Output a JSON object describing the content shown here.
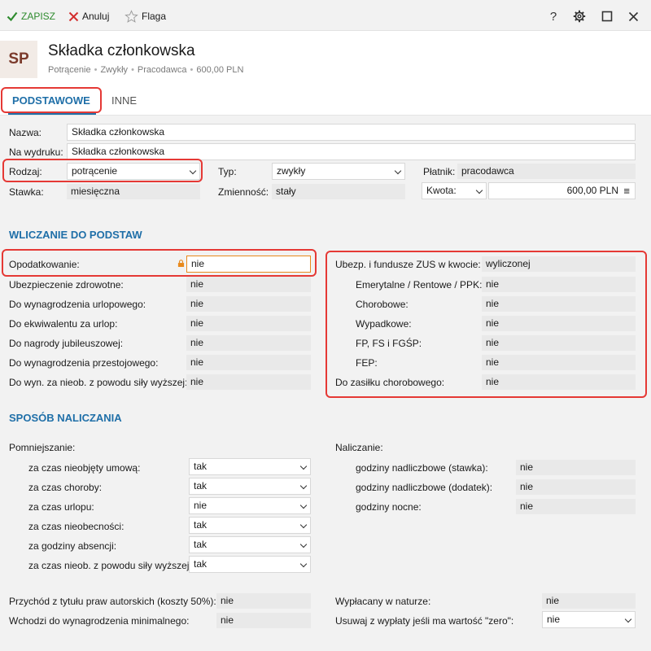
{
  "toolbar": {
    "save_label": "ZAPISZ",
    "cancel_label": "Anuluj",
    "flag_label": "Flaga",
    "help_label": "?"
  },
  "header": {
    "avatar": "SP",
    "title": "Składka członkowska",
    "crumbs": [
      "Potrącenie",
      "Zwykły",
      "Pracodawca",
      "600,00 PLN"
    ]
  },
  "tabs": [
    "PODSTAWOWE",
    "INNE"
  ],
  "form": {
    "nazwa_label": "Nazwa:",
    "nazwa_value": "Składka członkowska",
    "wydruk_label": "Na wydruku:",
    "wydruk_value": "Składka członkowska",
    "rodzaj_label": "Rodzaj:",
    "rodzaj_value": "potrącenie",
    "typ_label": "Typ:",
    "typ_value": "zwykły",
    "platnik_label": "Płatnik:",
    "platnik_value": "pracodawca",
    "stawka_label": "Stawka:",
    "stawka_value": "miesięczna",
    "zmiennosc_label": "Zmienność:",
    "zmiennosc_value": "stały",
    "kwota_label": "Kwota:",
    "kwota_value": "600,00 PLN",
    "kwota_menu": "≡"
  },
  "wliczanie": {
    "title": "WLICZANIE DO PODSTAW",
    "left": [
      {
        "label": "Opodatkowanie:",
        "value": "nie"
      },
      {
        "label": "Ubezpieczenie zdrowotne:",
        "value": "nie"
      },
      {
        "label": "Do wynagrodzenia urlopowego:",
        "value": "nie"
      },
      {
        "label": "Do ekwiwalentu za urlop:",
        "value": "nie"
      },
      {
        "label": "Do nagrody jubileuszowej:",
        "value": "nie"
      },
      {
        "label": "Do wynagrodzenia przestojowego:",
        "value": "nie"
      },
      {
        "label": "Do wyn. za nieob. z powodu siły wyższej:",
        "value": "nie"
      }
    ],
    "right": [
      {
        "label": "Ubezp. i fundusze ZUS w kwocie:",
        "value": "wyliczonej"
      },
      {
        "label": "Emerytalne / Rentowe / PPK:",
        "value": "nie"
      },
      {
        "label": "Chorobowe:",
        "value": "nie"
      },
      {
        "label": "Wypadkowe:",
        "value": "nie"
      },
      {
        "label": "FP, FS i FGŚP:",
        "value": "nie"
      },
      {
        "label": "FEP:",
        "value": "nie"
      },
      {
        "label": "Do zasiłku chorobowego:",
        "value": "nie"
      }
    ]
  },
  "sposob": {
    "title": "SPOSÓB NALICZANIA",
    "pomniejszanie_label": "Pomniejszanie:",
    "pomniejszanie": [
      {
        "label": "za czas nieobjęty umową:",
        "value": "tak"
      },
      {
        "label": "za czas choroby:",
        "value": "tak"
      },
      {
        "label": "za czas urlopu:",
        "value": "nie"
      },
      {
        "label": "za czas nieobecności:",
        "value": "tak"
      },
      {
        "label": "za godziny absencji:",
        "value": "tak"
      },
      {
        "label": "za czas nieob. z powodu siły wyższej:",
        "value": "tak"
      }
    ],
    "naliczanie_label": "Naliczanie:",
    "naliczanie": [
      {
        "label": "godziny nadliczbowe (stawka):",
        "value": "nie"
      },
      {
        "label": "godziny nadliczbowe (dodatek):",
        "value": "nie"
      },
      {
        "label": "godziny nocne:",
        "value": "nie"
      }
    ]
  },
  "bottom": {
    "przychod_label": "Przychód z tytułu praw autorskich (koszty 50%):",
    "przychod_value": "nie",
    "minimalne_label": "Wchodzi do wynagrodzenia minimalnego:",
    "minimalne_value": "nie",
    "natura_label": "Wypłacany w naturze:",
    "natura_value": "nie",
    "zero_label": "Usuwaj z wypłaty jeśli ma wartość \"zero\":",
    "zero_value": "nie"
  },
  "colors": {
    "accent": "#1f6fa8",
    "save_green": "#2e8b2e",
    "cancel_red": "#d32f2f",
    "highlight_red": "#e53935",
    "lock_orange": "#e8891c"
  }
}
